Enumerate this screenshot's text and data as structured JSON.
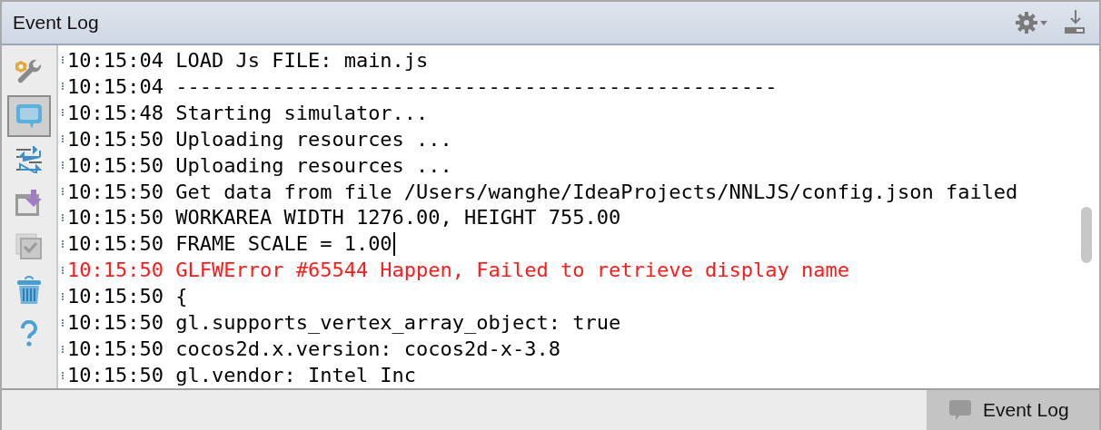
{
  "window": {
    "title": "Event Log"
  },
  "sidebar": {
    "tools": [
      {
        "selected": false
      },
      {
        "selected": true
      },
      {
        "selected": false
      },
      {
        "selected": false
      },
      {
        "selected": false
      },
      {
        "selected": false
      },
      {
        "selected": false
      }
    ]
  },
  "log": [
    {
      "time": "10:15:04",
      "message": "LOAD Js FILE: main.js",
      "kind": "info",
      "cursor": false
    },
    {
      "time": "10:15:04",
      "message": "--------------------------------------------------",
      "kind": "info",
      "cursor": false
    },
    {
      "time": "10:15:48",
      "message": "Starting simulator...",
      "kind": "info",
      "cursor": false
    },
    {
      "time": "10:15:50",
      "message": "Uploading resources ...",
      "kind": "info",
      "cursor": false
    },
    {
      "time": "10:15:50",
      "message": "Uploading resources ...",
      "kind": "info",
      "cursor": false
    },
    {
      "time": "10:15:50",
      "message": "Get data from file /Users/wanghe/IdeaProjects/NNLJS/config.json failed",
      "kind": "info",
      "cursor": false
    },
    {
      "time": "10:15:50",
      "message": "WORKAREA WIDTH 1276.00, HEIGHT 755.00",
      "kind": "info",
      "cursor": false
    },
    {
      "time": "10:15:50",
      "message": "FRAME SCALE = 1.00",
      "kind": "info",
      "cursor": true
    },
    {
      "time": "10:15:50",
      "message": "GLFWError #65544 Happen, Failed to retrieve display name",
      "kind": "error",
      "cursor": false
    },
    {
      "time": "10:15:50",
      "message": "{",
      "kind": "info",
      "cursor": false
    },
    {
      "time": "10:15:50",
      "message": "gl.supports_vertex_array_object: true",
      "kind": "info",
      "cursor": false
    },
    {
      "time": "10:15:50",
      "message": "cocos2d.x.version: cocos2d-x-3.8",
      "kind": "info",
      "cursor": false
    },
    {
      "time": "10:15:50",
      "message": "gl.vendor: Intel Inc",
      "kind": "info",
      "cursor": false
    }
  ],
  "status_bar": {
    "button": {
      "label": "Event Log",
      "selected": true
    }
  }
}
